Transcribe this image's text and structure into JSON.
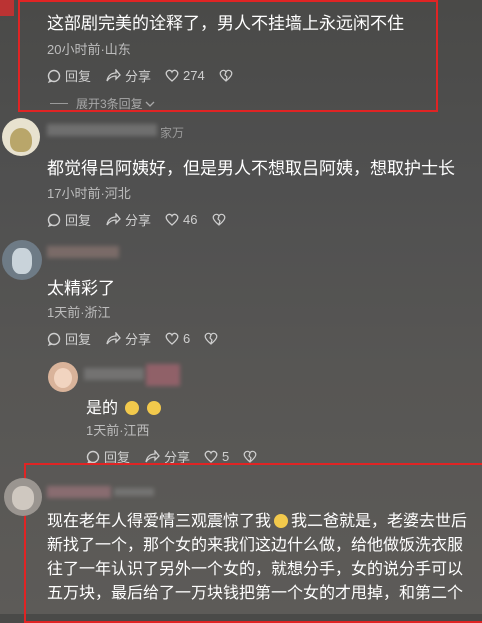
{
  "comments": [
    {
      "text": "这部剧完美的诠释了，男人不挂墙上永远闲不住",
      "meta": "20小时前·山东",
      "reply": "回复",
      "share": "分享",
      "likes": "274",
      "expand": "展开3条回复"
    },
    {
      "user": "家万",
      "text": "都觉得吕阿姨好，但是男人不想取吕阿姨，想取护士长",
      "meta": "17小时前·河北",
      "reply": "回复",
      "share": "分享",
      "likes": "46"
    },
    {
      "text": "太精彩了",
      "meta": "1天前·浙江",
      "reply": "回复",
      "share": "分享",
      "likes": "6"
    },
    {
      "text": "是的",
      "meta": "1天前·江西",
      "reply": "回复",
      "share": "分享",
      "likes": "5"
    },
    {
      "lines": [
        "现在老年人得爱情三观震惊了我",
        "我二爸就是，老婆去世后",
        "新找了一个，那个女的来我们这边什么做，给他做饭洗衣服",
        "往了一年认识了另外一个女的，就想分手，女的说分手可以",
        "五万块，最后给了一万块钱把第一个女的才甩掉，和第二个"
      ]
    }
  ],
  "colors": {
    "highlight": "#e02424",
    "text": "#ffffff",
    "meta": "#bdbdbd"
  }
}
